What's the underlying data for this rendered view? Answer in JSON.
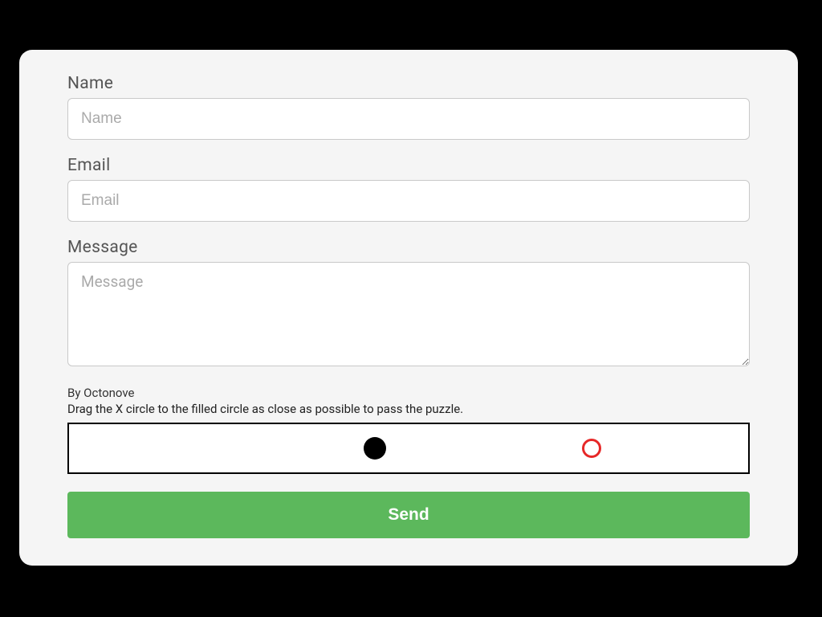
{
  "form": {
    "name": {
      "label": "Name",
      "placeholder": "Name",
      "value": ""
    },
    "email": {
      "label": "Email",
      "placeholder": "Email",
      "value": ""
    },
    "message": {
      "label": "Message",
      "placeholder": "Message",
      "value": ""
    }
  },
  "captcha": {
    "byline": "By Octonove",
    "instruction": "Drag the X circle to the filled circle as close as possible to pass the puzzle."
  },
  "submit": {
    "label": "Send"
  }
}
